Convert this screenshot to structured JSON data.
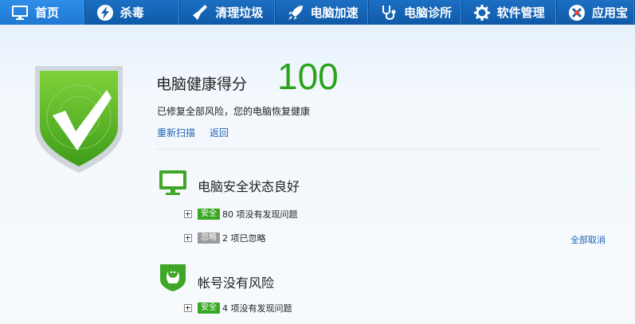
{
  "nav": {
    "items": [
      {
        "label": "首页",
        "icon": "monitor-icon"
      },
      {
        "label": "杀毒",
        "icon": "lightning-icon"
      },
      {
        "label": "清理垃圾",
        "icon": "broom-icon"
      },
      {
        "label": "电脑加速",
        "icon": "rocket-icon"
      },
      {
        "label": "电脑诊所",
        "icon": "stethoscope-icon"
      },
      {
        "label": "软件管理",
        "icon": "gear-icon"
      },
      {
        "label": "应用宝",
        "icon": "app-store-icon"
      }
    ],
    "active_index": 0
  },
  "health": {
    "title": "电脑健康得分",
    "score": "100",
    "description": "已修复全部风险，您的电脑恢复健康",
    "rescan_label": "重新扫描",
    "back_label": "返回"
  },
  "sections": [
    {
      "title": "电脑安全状态良好",
      "icon": "monitor-icon",
      "rows": [
        {
          "badge": "安全",
          "text": "80 项没有发现问题"
        },
        {
          "badge": "忽略",
          "text": "2 项已忽略"
        }
      ],
      "action_label": "全部取消"
    },
    {
      "title": "帐号没有风险",
      "icon": "qq-penguin-icon",
      "rows": [
        {
          "badge": "安全",
          "text": "4 项没有发现问题"
        }
      ]
    }
  ],
  "colors": {
    "nav_bg": "#1463b4",
    "score_green": "#2aa31c",
    "link_blue": "#1d64b4",
    "badge_safe": "#3aa823",
    "badge_ignore": "#9a9a9a"
  }
}
